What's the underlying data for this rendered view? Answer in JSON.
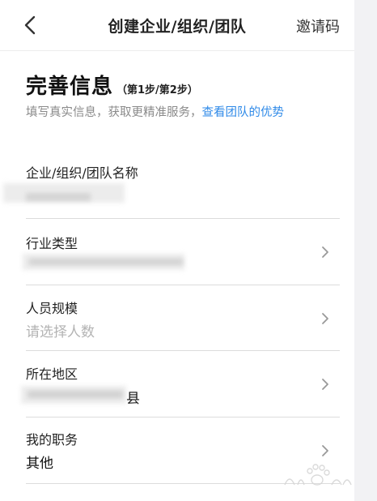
{
  "navbar": {
    "title": "创建企业/组织/团队",
    "right_action": "邀请码"
  },
  "heading": {
    "main": "完善信息",
    "step": "（第1步/第2步）"
  },
  "subtitle": {
    "text": "填写真实信息，获取更精准服务，",
    "link": "查看团队的优势"
  },
  "fields": {
    "org_name": {
      "label": "企业/组织/团队名称",
      "value": ""
    },
    "industry": {
      "label": "行业类型",
      "value": ""
    },
    "staff_size": {
      "label": "人员规模",
      "placeholder": "请选择人数"
    },
    "region": {
      "label": "所在地区",
      "value": "县"
    },
    "position": {
      "label": "我的职务",
      "value": "其他"
    }
  },
  "colors": {
    "link": "#2f8ae8",
    "placeholder": "#b3b3b3",
    "divider": "#dcdcdc"
  }
}
